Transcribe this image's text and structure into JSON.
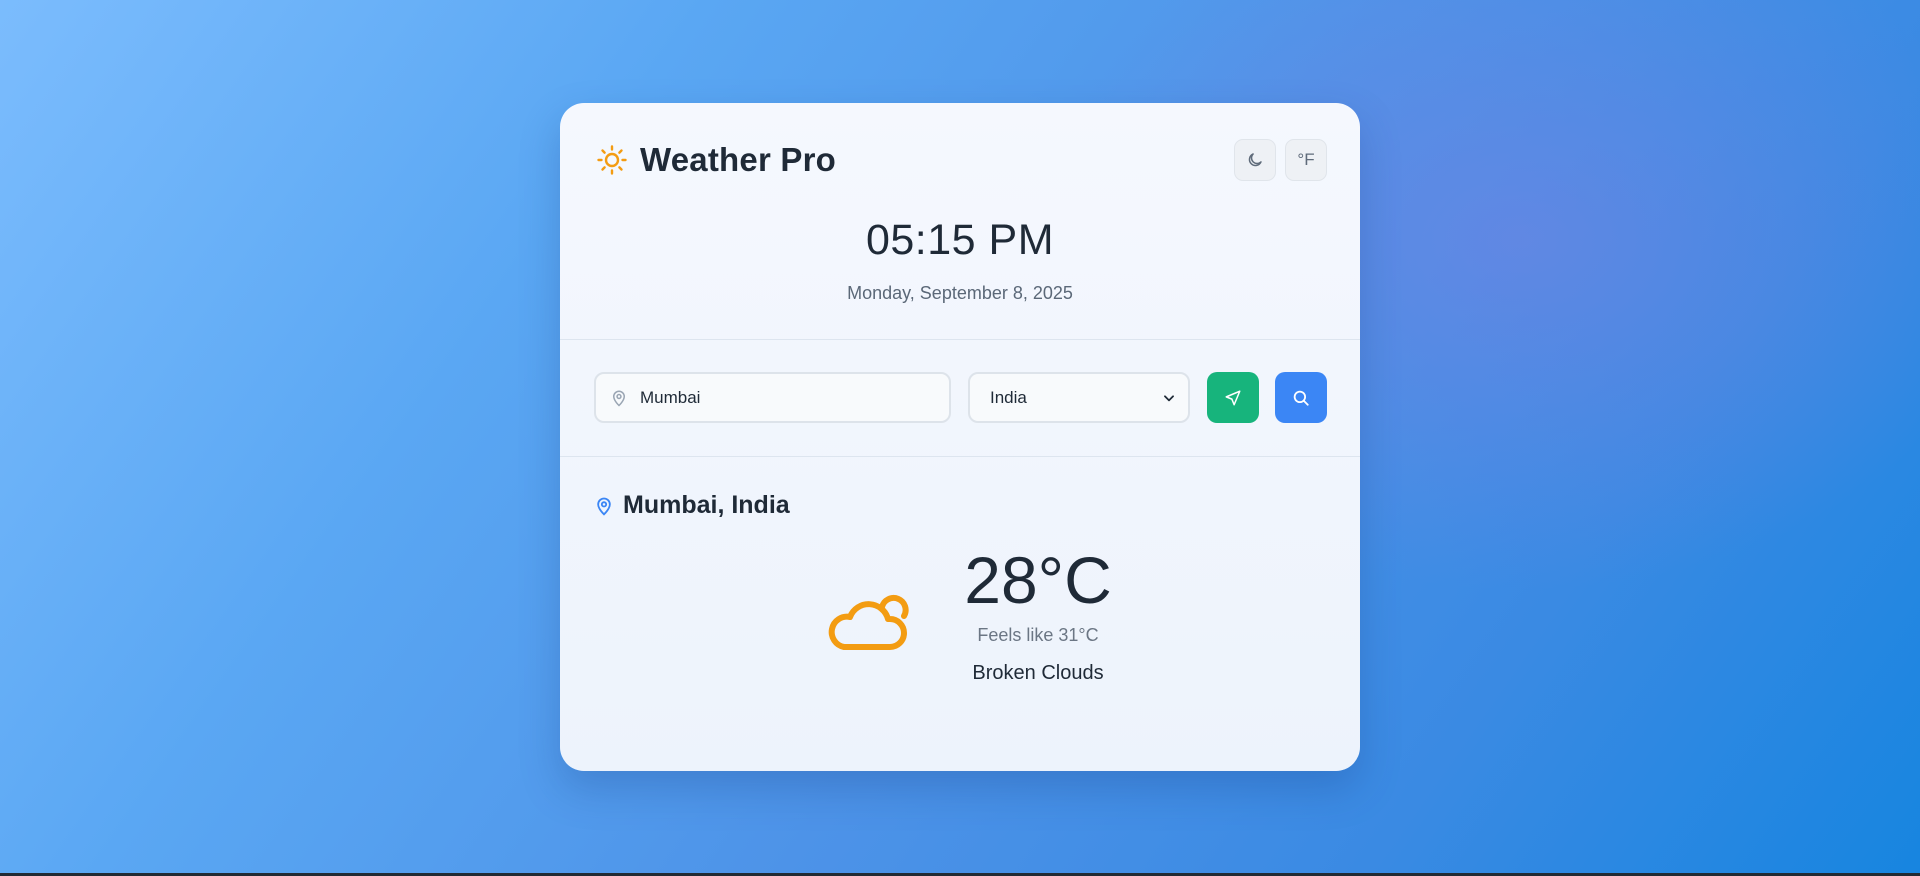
{
  "app": {
    "title": "Weather Pro",
    "brand_icon": "sun-icon",
    "theme_toggle_icon": "moon-icon",
    "unit_toggle_label": "°F"
  },
  "clock": {
    "time": "05:15 PM",
    "date": "Monday, September 8, 2025"
  },
  "search": {
    "city_value": "Mumbai",
    "city_icon": "map-pin-icon",
    "country_selected": "India",
    "locate_button_icon": "navigation-arrow-icon",
    "search_button_icon": "search-icon"
  },
  "weather": {
    "location": "Mumbai, India",
    "temperature": "28°C",
    "feels_like": "Feels like 31°C",
    "condition": "Broken Clouds",
    "condition_icon": "cloud-icon"
  },
  "colors": {
    "accent_green": "#17b47c",
    "accent_blue": "#3b86f5",
    "sun_orange": "#f39c12",
    "text_dark": "#1f2a37"
  }
}
